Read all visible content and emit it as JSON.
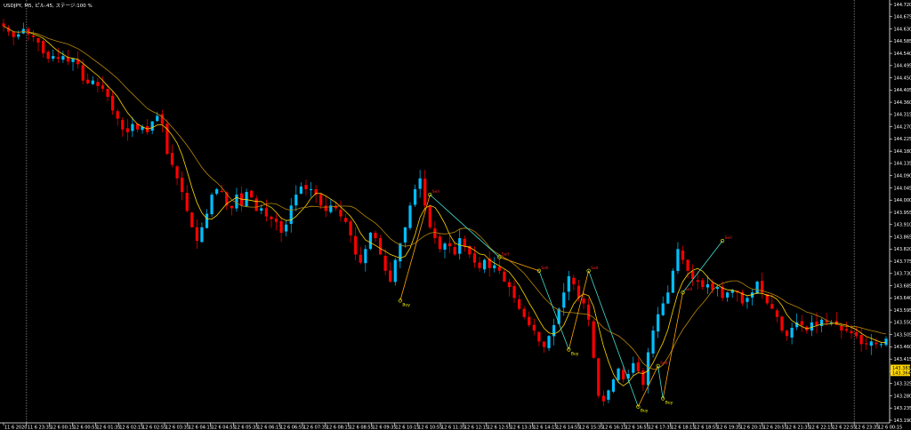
{
  "window": {
    "title": "USDJPY, M5, ピル:45, ステージ:100 %"
  },
  "colors": {
    "background": "#000000",
    "bull_candle": "#00bfff",
    "bear_candle": "#ff0000",
    "ma_fast": "#ffd700",
    "ma_slow": "#b8860b",
    "signal_line": "#ffa500",
    "signal_line2": "#40e0d0",
    "buy_label": "#ffff00",
    "sell_label": "#ff2020",
    "price_tag_bg": "#ffd700",
    "axis_text": "#ffffff"
  },
  "price_tags": [
    {
      "label": "143.383",
      "value": 143.383
    },
    {
      "label": "143.364",
      "value": 143.364
    }
  ],
  "chart_data": {
    "type": "candlestick",
    "title": "USDJPY, M5, ピル:45, ステージ:100 %",
    "ylim": [
      143.19,
      144.72
    ],
    "y_ticks": [
      "144.720",
      "144.675",
      "144.630",
      "144.585",
      "144.540",
      "144.495",
      "144.450",
      "144.405",
      "144.360",
      "144.315",
      "144.270",
      "144.225",
      "144.180",
      "144.135",
      "144.090",
      "144.045",
      "144.000",
      "143.955",
      "143.910",
      "143.865",
      "143.820",
      "143.775",
      "143.730",
      "143.685",
      "143.640",
      "143.595",
      "143.550",
      "143.505",
      "143.460",
      "143.415",
      "143.370",
      "143.325",
      "143.280",
      "143.235",
      "143.190"
    ],
    "x_ticks": [
      "11 6 2020",
      "11 6 23:35",
      "12 6 00:15",
      "12 6 00:55",
      "12 6 01:35",
      "12 6 02:15",
      "12 6 02:55",
      "12 6 03:35",
      "12 6 04:15",
      "12 6 04:55",
      "12 6 05:35",
      "12 6 06:15",
      "12 6 06:55",
      "12 6 07:35",
      "12 6 08:15",
      "12 6 08:55",
      "12 6 09:35",
      "12 6 10:15",
      "12 6 10:55",
      "12 6 11:35",
      "12 6 12:15",
      "12 6 12:55",
      "12 6 13:35",
      "12 6 14:15",
      "12 6 14:55",
      "12 6 15:35",
      "12 6 16:15",
      "12 6 16:55",
      "12 6 17:35",
      "12 6 18:15",
      "12 6 18:55",
      "12 6 19:35",
      "12 6 20:15",
      "12 6 20:55",
      "12 6 21:35",
      "12 6 22:15",
      "12 6 22:55",
      "12 6 23:35",
      "12 6 00:15"
    ],
    "period_separators": [
      "11 6 23:35",
      "12 6 23:35"
    ],
    "close_path": [
      144.64,
      144.62,
      144.6,
      144.61,
      144.63,
      144.61,
      144.6,
      144.58,
      144.54,
      144.52,
      144.53,
      144.52,
      144.53,
      144.51,
      144.52,
      144.5,
      144.44,
      144.43,
      144.44,
      144.42,
      144.41,
      144.38,
      144.33,
      144.3,
      144.26,
      144.25,
      144.28,
      144.26,
      144.27,
      144.25,
      144.29,
      144.31,
      144.28,
      144.17,
      144.13,
      144.08,
      144.03,
      143.96,
      143.9,
      143.85,
      143.9,
      143.95,
      144.02,
      144.04,
      144.03,
      143.98,
      143.97,
      144.02,
      143.98,
      144.03,
      144.01,
      143.96,
      143.97,
      143.94,
      143.93,
      143.92,
      143.88,
      143.91,
      143.98,
      144.02,
      144.05,
      144.04,
      144.04,
      144.02,
      143.98,
      143.96,
      143.98,
      143.97,
      143.94,
      143.92,
      143.87,
      143.8,
      143.77,
      143.82,
      143.88,
      143.86,
      143.8,
      143.74,
      143.7,
      143.78,
      143.84,
      143.9,
      143.98,
      144.04,
      144.08,
      143.98,
      143.9,
      143.86,
      143.82,
      143.84,
      143.83,
      143.8,
      143.86,
      143.83,
      143.8,
      143.77,
      143.75,
      143.78,
      143.75,
      143.76,
      143.74,
      143.7,
      143.68,
      143.64,
      143.6,
      143.57,
      143.54,
      143.52,
      143.48,
      143.46,
      143.5,
      143.54,
      143.6,
      143.66,
      143.72,
      143.69,
      143.64,
      143.62,
      143.56,
      143.42,
      143.28,
      143.26,
      143.3,
      143.34,
      143.38,
      143.34,
      143.36,
      143.4,
      143.37,
      143.32,
      143.44,
      143.52,
      143.58,
      143.62,
      143.66,
      143.74,
      143.82,
      143.78,
      143.74,
      143.71,
      143.7,
      143.68,
      143.69,
      143.67,
      143.68,
      143.64,
      143.66,
      143.67,
      143.66,
      143.62,
      143.64,
      143.66,
      143.7,
      143.66,
      143.62,
      143.6,
      143.57,
      143.52,
      143.5,
      143.53,
      143.55,
      143.54,
      143.52,
      143.55,
      143.54,
      143.56,
      143.55,
      143.55,
      143.54,
      143.52,
      143.52,
      143.51,
      143.5,
      143.47,
      143.47,
      143.48,
      143.47,
      143.47,
      143.49
    ]
  },
  "signals": [
    {
      "label": "Sell",
      "type": "sell",
      "at": 86,
      "price": 144.02
    },
    {
      "label": "Buy",
      "type": "buy",
      "at": 80,
      "price": 143.63
    },
    {
      "label": "Sell",
      "type": "sell",
      "at": 100,
      "price": 143.79
    },
    {
      "label": "Sell",
      "type": "sell",
      "at": 108,
      "price": 143.74
    },
    {
      "label": "Buy",
      "type": "buy",
      "at": 114,
      "price": 143.45
    },
    {
      "label": "Sell",
      "type": "sell",
      "at": 118,
      "price": 143.74
    },
    {
      "label": "Buy",
      "type": "buy",
      "at": 128,
      "price": 143.24
    },
    {
      "label": "Sell",
      "type": "sell",
      "at": 132,
      "price": 143.39
    },
    {
      "label": "Buy",
      "type": "buy",
      "at": 133,
      "price": 143.27
    },
    {
      "label": "Sell",
      "type": "sell",
      "at": 145,
      "price": 143.85
    },
    {
      "label": "Sell",
      "type": "sell",
      "at": 137,
      "price": 143.66
    }
  ]
}
